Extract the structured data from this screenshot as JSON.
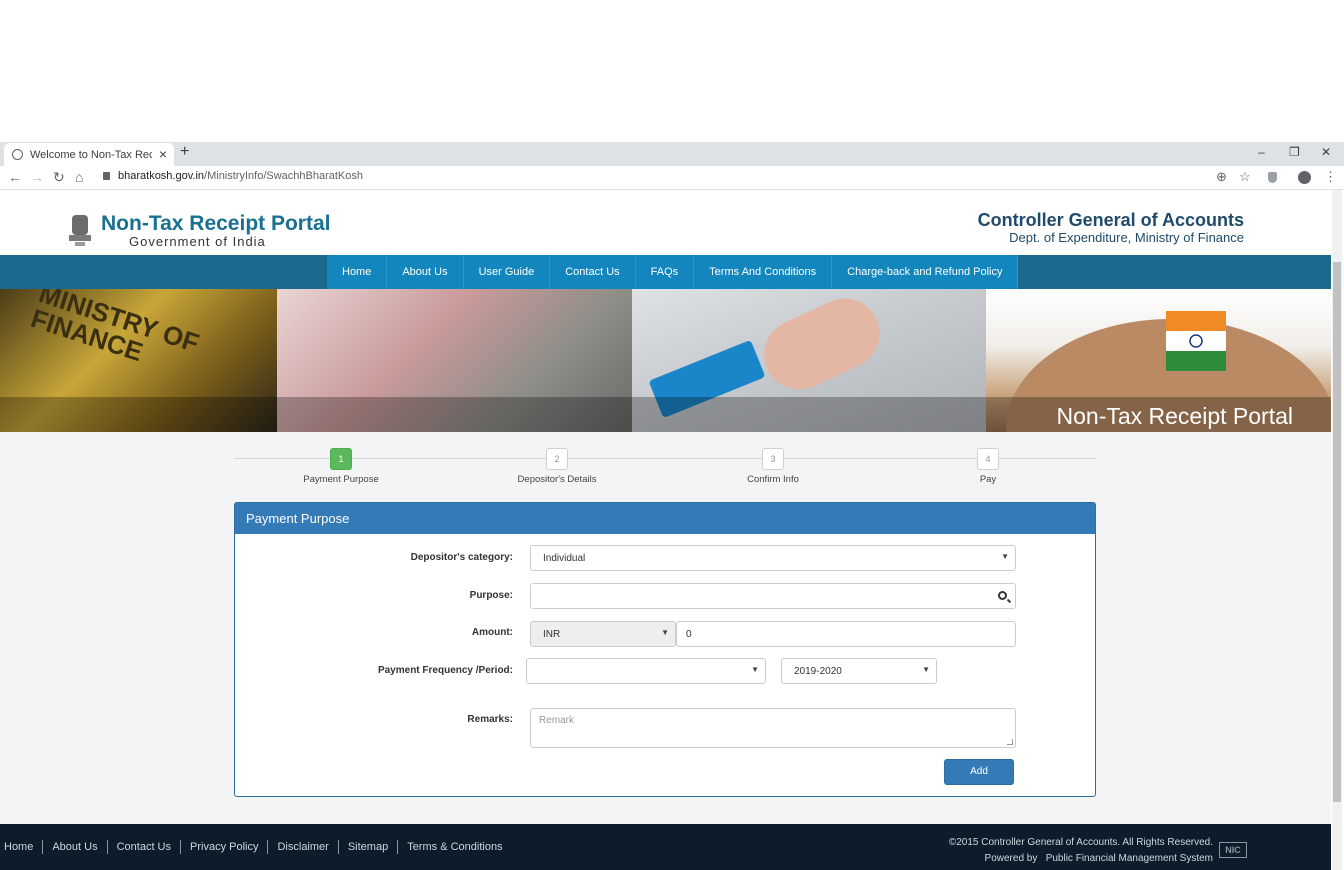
{
  "browser": {
    "tab_title": "Welcome to Non-Tax Receipt Po",
    "tab_close": "×",
    "new_tab": "+",
    "url_host": "bharatkosh.gov.in",
    "url_path": "/MinistryInfo/SwachhBharatKosh",
    "minimize": "–",
    "restore": "❐",
    "close": "✕",
    "back": "←",
    "forward": "→",
    "reload": "↻",
    "home": "⌂",
    "zoom": "⊕",
    "star": "☆",
    "menu": "⋮"
  },
  "header": {
    "portal_title": "Non-Tax Receipt Portal",
    "portal_subtitle": "Government of India",
    "cga_title": "Controller General of Accounts",
    "cga_subtitle": "Dept. of Expenditure, Ministry of Finance"
  },
  "nav": {
    "items": [
      "Home",
      "About Us",
      "User Guide",
      "Contact Us",
      "FAQs",
      "Terms And Conditions",
      "Charge-back and Refund Policy"
    ]
  },
  "banner": {
    "ministry_text": "MINISTRY OF FINANCE",
    "caption": "Non-Tax Receipt Portal"
  },
  "steps": [
    {
      "num": "1",
      "label": "Payment Purpose"
    },
    {
      "num": "2",
      "label": "Depositor's Details"
    },
    {
      "num": "3",
      "label": "Confirm Info"
    },
    {
      "num": "4",
      "label": "Pay"
    }
  ],
  "form": {
    "title": "Payment Purpose",
    "category_label": "Depositor's category:",
    "category_value": "Individual",
    "purpose_label": "Purpose:",
    "purpose_value": "",
    "amount_label": "Amount:",
    "currency_value": "INR",
    "amount_value": "0",
    "frequency_label": "Payment Frequency /Period:",
    "frequency_value": "",
    "period_value": "2019-2020",
    "remarks_label": "Remarks:",
    "remarks_placeholder": "Remark",
    "add_label": "Add"
  },
  "footer": {
    "links": [
      "Home",
      "About Us",
      "Contact Us",
      "Privacy Policy",
      "Disclaimer",
      "Sitemap",
      "Terms & Conditions"
    ],
    "copyright": "©2015 Controller General of Accounts. All Rights Reserved.",
    "powered": "Powered by   Public Financial Management System",
    "nic": "NIC"
  }
}
